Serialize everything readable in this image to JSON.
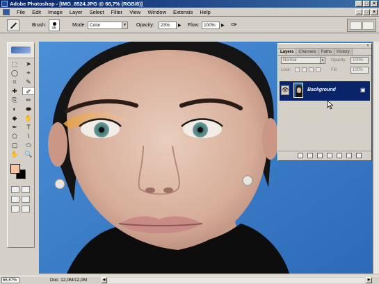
{
  "window": {
    "title": "Adobe Photoshop - [IMG_8524.JPG @ 66,7% (RGB/8)]",
    "controls": [
      "_",
      "□",
      "×"
    ]
  },
  "menu": [
    "File",
    "Edit",
    "Image",
    "Layer",
    "Select",
    "Filter",
    "View",
    "Window",
    "Extensis",
    "Help"
  ],
  "options_bar": {
    "brush_label": "Brush:",
    "brush_size": "65",
    "mode_label": "Mode:",
    "mode_value": "Color",
    "opacity_label": "Opacity:",
    "opacity_value": "23%",
    "flow_label": "Flow:",
    "flow_value": "100%"
  },
  "toolbox": {
    "tools": [
      "⬚",
      "➤",
      "◯",
      "⌖",
      "⌗",
      "✎",
      "✚",
      "✐",
      "⎘",
      "✏",
      "◐",
      "⬬",
      "◆",
      "✋",
      "✒",
      "T",
      "⬠",
      "\\",
      "▢",
      "⬭",
      "✋",
      "🔍"
    ],
    "foreground_color": "#f4c49e",
    "background_color": "#000000"
  },
  "layers_panel": {
    "tabs": [
      "Layers",
      "Channels",
      "Paths",
      "History"
    ],
    "blend_mode": "Normal",
    "opacity_label": "Opacity:",
    "opacity_value": "100%",
    "lock_label": "Lock:",
    "fill_label": "Fill:",
    "fill_value": "100%",
    "layer_name": "Background",
    "eye_icon": "👁",
    "lock_icon": "🔒"
  },
  "status_bar": {
    "zoom": "66,67%",
    "doc": "Doc: 12,0M/12,0M"
  }
}
